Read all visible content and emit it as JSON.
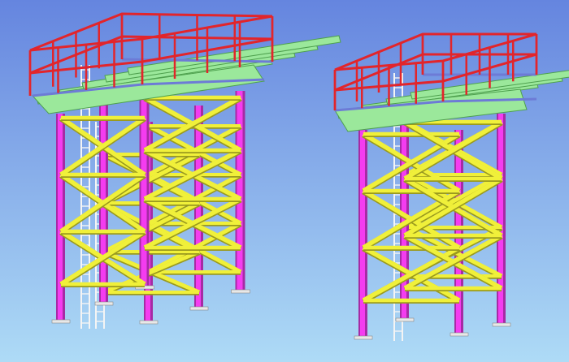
{
  "viewport": {
    "name": "3d-model-viewport",
    "background_top": "#6585DF",
    "background_bottom": "#AEDBF6"
  },
  "colors": {
    "column": "#F43CF0",
    "column_shade": "#A62BA4",
    "bracing": "#F0F03A",
    "bracing_shade": "#9A9A1E",
    "beam": "#9BE89B",
    "beam_shade": "#4EA04E",
    "handrail": "#E2252B",
    "edge_beam": "#6D7BD6",
    "ladder": "#F4F4F4",
    "base_plate": "#E8E8E8"
  },
  "structures": [
    {
      "name": "tower-structure-left",
      "icon": "steel-tower-icon"
    },
    {
      "name": "tower-structure-right",
      "icon": "steel-tower-icon"
    }
  ]
}
